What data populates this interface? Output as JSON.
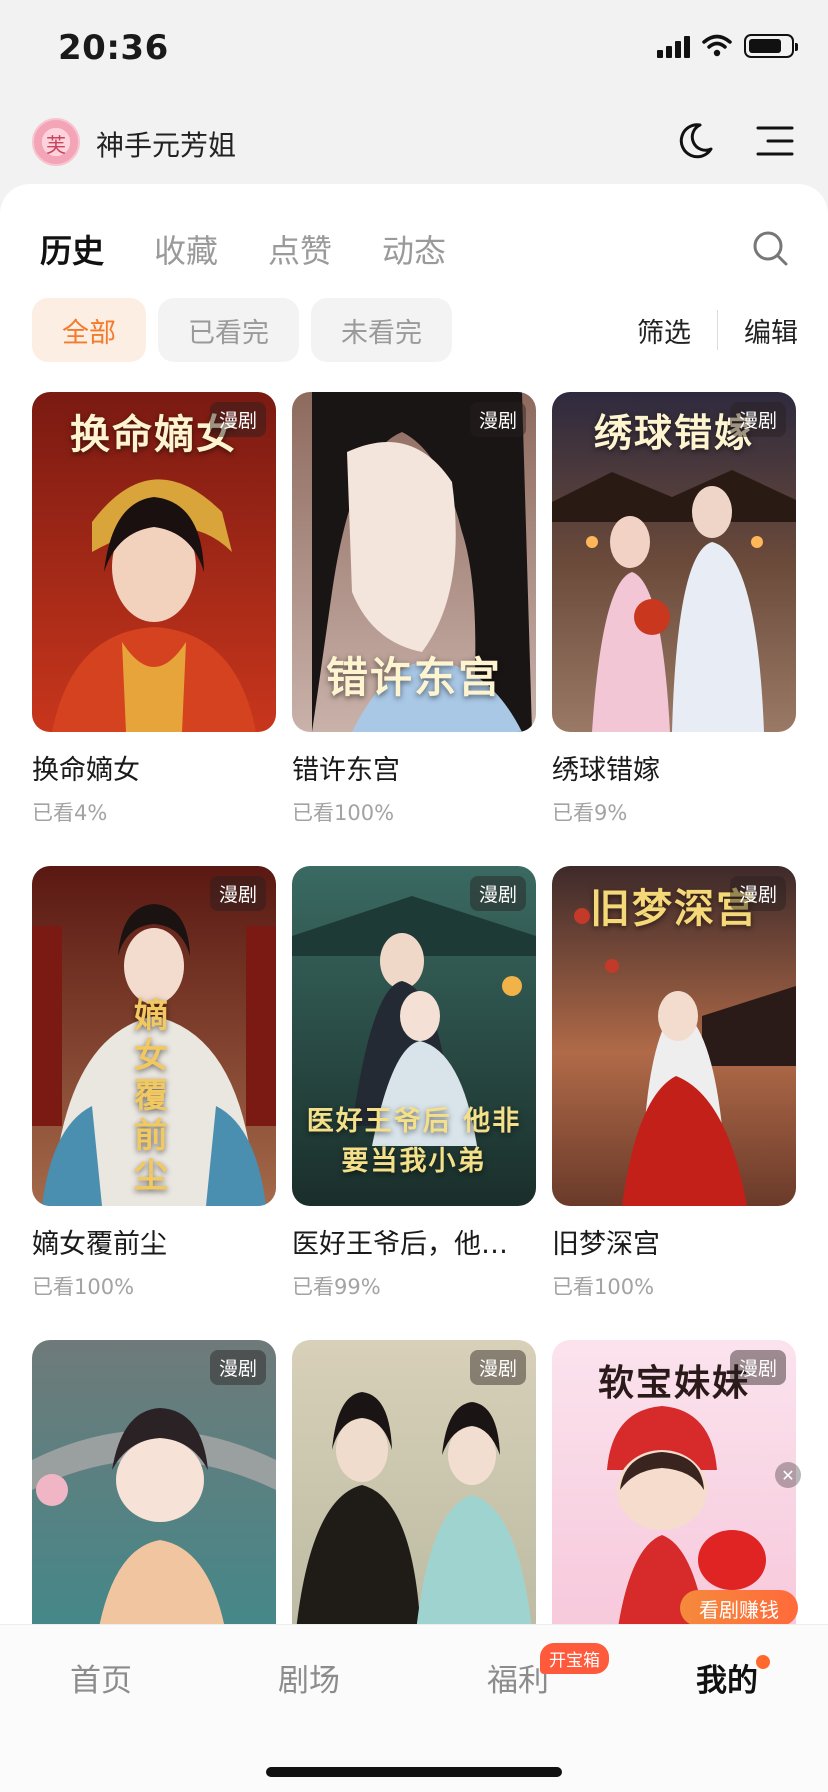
{
  "status_bar": {
    "time": "20:36"
  },
  "header": {
    "username": "神手元芳姐"
  },
  "tabs": [
    {
      "label": "历史",
      "active": true
    },
    {
      "label": "收藏",
      "active": false
    },
    {
      "label": "点赞",
      "active": false
    },
    {
      "label": "动态",
      "active": false
    }
  ],
  "filters": {
    "chips": [
      {
        "label": "全部",
        "active": true
      },
      {
        "label": "已看完",
        "active": false
      },
      {
        "label": "未看完",
        "active": false
      }
    ],
    "filter_label": "筛选",
    "edit_label": "编辑"
  },
  "items": [
    {
      "title": "换命嫡女",
      "progress": "已看4%",
      "badge": "漫剧",
      "poster_text": "换命嫡女"
    },
    {
      "title": "错许东宫",
      "progress": "已看100%",
      "badge": "漫剧",
      "poster_text": "错许东宫"
    },
    {
      "title": "绣球错嫁",
      "progress": "已看9%",
      "badge": "漫剧",
      "poster_text": "绣球错嫁"
    },
    {
      "title": "嫡女覆前尘",
      "progress": "已看100%",
      "badge": "漫剧",
      "poster_text": "嫡女覆前尘"
    },
    {
      "title": "医好王爷后，他…",
      "progress": "已看99%",
      "badge": "漫剧",
      "poster_text": "医好王爷后 他非要当我小弟"
    },
    {
      "title": "旧梦深宫",
      "progress": "已看100%",
      "badge": "漫剧",
      "poster_text": "旧梦深宫"
    },
    {
      "title": "",
      "progress": "",
      "badge": "漫剧",
      "poster_text": ""
    },
    {
      "title": "",
      "progress": "",
      "badge": "漫剧",
      "poster_text": ""
    },
    {
      "title": "",
      "progress": "",
      "badge": "漫剧",
      "poster_text": "软宝妹妹"
    }
  ],
  "promo": {
    "label": "看剧赚钱"
  },
  "bottom_nav": [
    {
      "label": "首页",
      "active": false
    },
    {
      "label": "剧场",
      "active": false
    },
    {
      "label": "福利",
      "active": false,
      "badge": "开宝箱"
    },
    {
      "label": "我的",
      "active": true
    }
  ],
  "colors": {
    "accent": "#f47b2b",
    "chip_active_bg": "#fdeee3",
    "badge_red": "#ff5a3c"
  }
}
